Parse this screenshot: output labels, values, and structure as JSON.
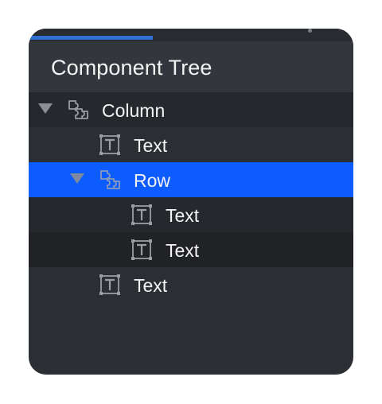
{
  "panel": {
    "title": "Component Tree"
  },
  "tree": {
    "nodes": [
      {
        "label": "Column",
        "icon": "puzzle-icon",
        "depth": 0,
        "expanded": true,
        "selected": false
      },
      {
        "label": "Text",
        "icon": "text-component-icon",
        "depth": 1,
        "expanded": null,
        "selected": false
      },
      {
        "label": "Row",
        "icon": "puzzle-icon",
        "depth": 1,
        "expanded": true,
        "selected": true
      },
      {
        "label": "Text",
        "icon": "text-component-icon",
        "depth": 2,
        "expanded": null,
        "selected": false
      },
      {
        "label": "Text",
        "icon": "text-component-icon",
        "depth": 2,
        "expanded": null,
        "selected": false
      },
      {
        "label": "Text",
        "icon": "text-component-icon",
        "depth": 1,
        "expanded": null,
        "selected": false
      }
    ]
  },
  "colors": {
    "panel_bg": "#2b2e33",
    "header_bg": "#33363c",
    "selection": "#0d5cff",
    "tab_indicator": "#2f6fd1",
    "icon_stroke": "#9a9da2"
  }
}
